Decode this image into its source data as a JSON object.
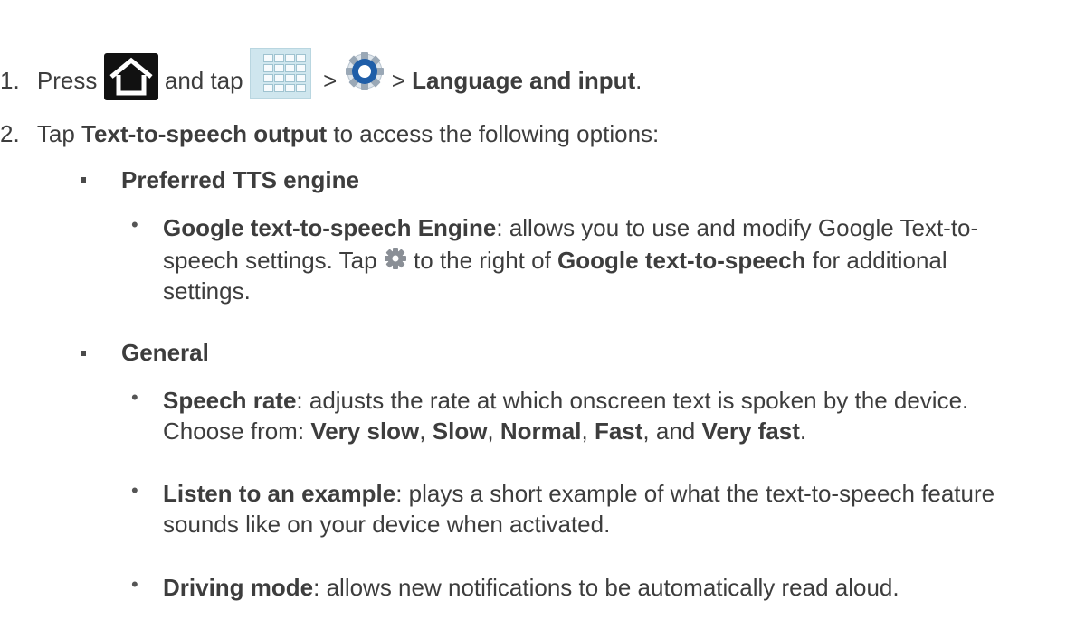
{
  "step1": {
    "num": "1.",
    "press": "Press",
    "and_tap": "and tap",
    "sep1": ">",
    "sep2": ">",
    "target": "Language and input",
    "end": "."
  },
  "step2": {
    "num": "2.",
    "tap": "Tap",
    "target": "Text-to-speech output",
    "rest": "to access the following options:"
  },
  "pref": {
    "heading": "Preferred TTS engine",
    "google_bold": "Google text-to-speech Engine",
    "google_rest": ": allows you to use and modify Google Text-to-",
    "line2_a": "speech settings. Tap",
    "line2_b": "to the right of",
    "line2_bold": "Google text-to-speech",
    "line2_c": "for additional",
    "line3": "settings."
  },
  "general": {
    "heading": "General",
    "rate_bold": "Speech rate",
    "rate_rest": ": adjusts the rate at which onscreen text is spoken by the device.",
    "choose": "Choose from:",
    "opt1": "Very slow",
    "comma1": ",",
    "opt2": "Slow",
    "comma2": ",",
    "opt3": "Normal",
    "comma3": ",",
    "opt4": "Fast",
    "and": ", and",
    "opt5": "Very fast",
    "period": ".",
    "listen_bold": "Listen to an example",
    "listen_rest": ": plays a short example of what the text-to-speech feature",
    "listen_line2": "sounds like on your device when activated.",
    "driving_bold": "Driving mode",
    "driving_rest": ": allows new notifications to be automatically read aloud."
  },
  "icons": [
    "home-icon",
    "apps-icon",
    "settings-icon",
    "gear-icon"
  ]
}
